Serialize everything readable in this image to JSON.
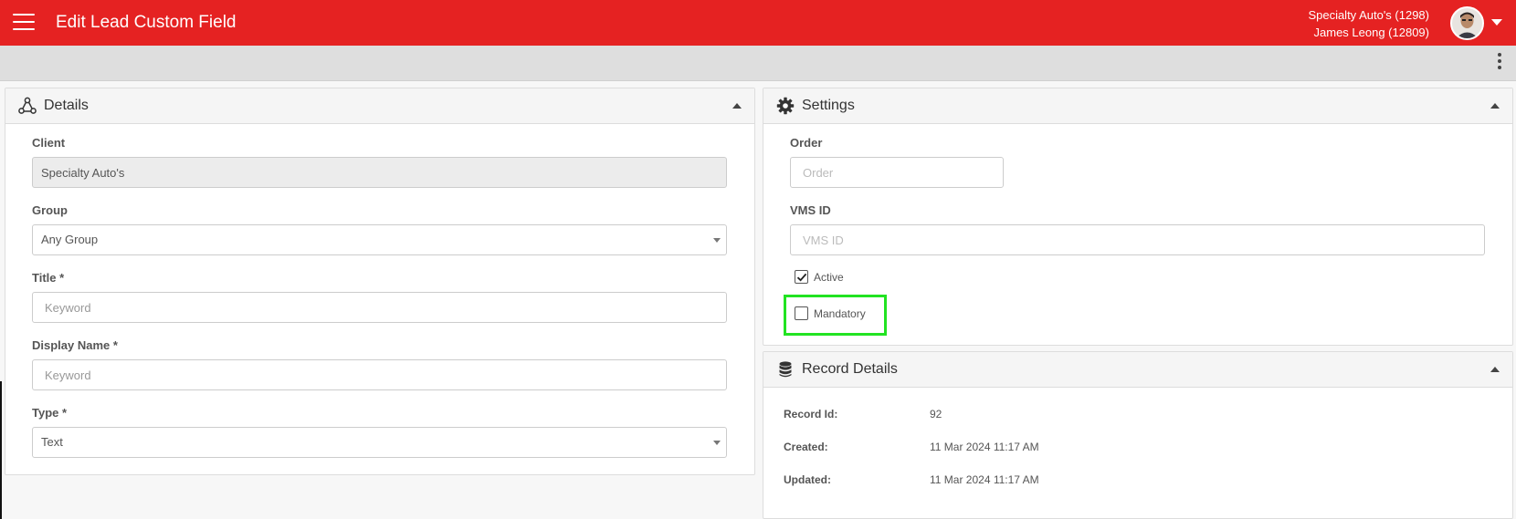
{
  "header": {
    "title": "Edit Lead Custom Field",
    "client_line": "Specialty Auto's (1298)",
    "user_line": "James Leong (12809)"
  },
  "colors": {
    "brand": "#e52222",
    "highlight": "#22e322"
  },
  "details": {
    "title": "Details",
    "client": {
      "label": "Client",
      "value": "Specialty Auto's"
    },
    "group": {
      "label": "Group",
      "value": "Any Group"
    },
    "title_field": {
      "label": "Title *",
      "placeholder": "Keyword"
    },
    "display_name": {
      "label": "Display Name *",
      "placeholder": "Keyword"
    },
    "type": {
      "label": "Type *",
      "value": "Text"
    }
  },
  "settings": {
    "title": "Settings",
    "order": {
      "label": "Order",
      "placeholder": "Order"
    },
    "vms_id": {
      "label": "VMS ID",
      "placeholder": "VMS ID"
    },
    "active": {
      "label": "Active",
      "checked": true
    },
    "mandatory": {
      "label": "Mandatory",
      "checked": false
    }
  },
  "record_details": {
    "title": "Record Details",
    "rows": [
      {
        "label": "Record Id:",
        "value": "92"
      },
      {
        "label": "Created:",
        "value": "11 Mar 2024 11:17 AM"
      },
      {
        "label": "Updated:",
        "value": "11 Mar 2024 11:17 AM"
      }
    ]
  }
}
